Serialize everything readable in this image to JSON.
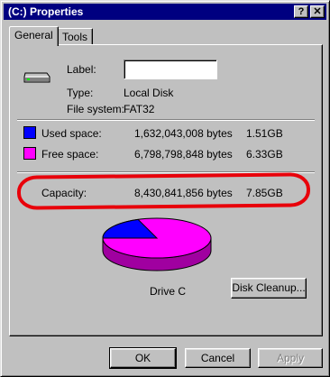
{
  "window": {
    "title": "(C:) Properties",
    "help_glyph": "?",
    "close_glyph": "✕"
  },
  "tabs": [
    {
      "label": "General",
      "active": true
    },
    {
      "label": "Tools",
      "active": false
    }
  ],
  "general": {
    "icon": "hard-drive-icon",
    "label_caption": "Label:",
    "label_value": "",
    "type_caption": "Type:",
    "type_value": "Local Disk",
    "fs_caption": "File system:",
    "fs_value": "FAT32",
    "used": {
      "caption": "Used space:",
      "bytes": "1,632,043,008 bytes",
      "size": "1.51GB",
      "color": "#0000ff"
    },
    "free": {
      "caption": "Free space:",
      "bytes": "6,798,798,848 bytes",
      "size": "6.33GB",
      "color": "#ff00ff"
    },
    "capacity": {
      "caption": "Capacity:",
      "bytes": "8,430,841,856 bytes",
      "size": "7.85GB"
    },
    "annotation_color": "#e8000a",
    "pie": {
      "used_fraction": 0.1936,
      "used_color": "#0000ff",
      "free_color": "#ff00ff"
    },
    "drive_caption": "Drive C",
    "cleanup_button": "Disk Cleanup..."
  },
  "buttons": {
    "ok": "OK",
    "cancel": "Cancel",
    "apply": "Apply"
  }
}
